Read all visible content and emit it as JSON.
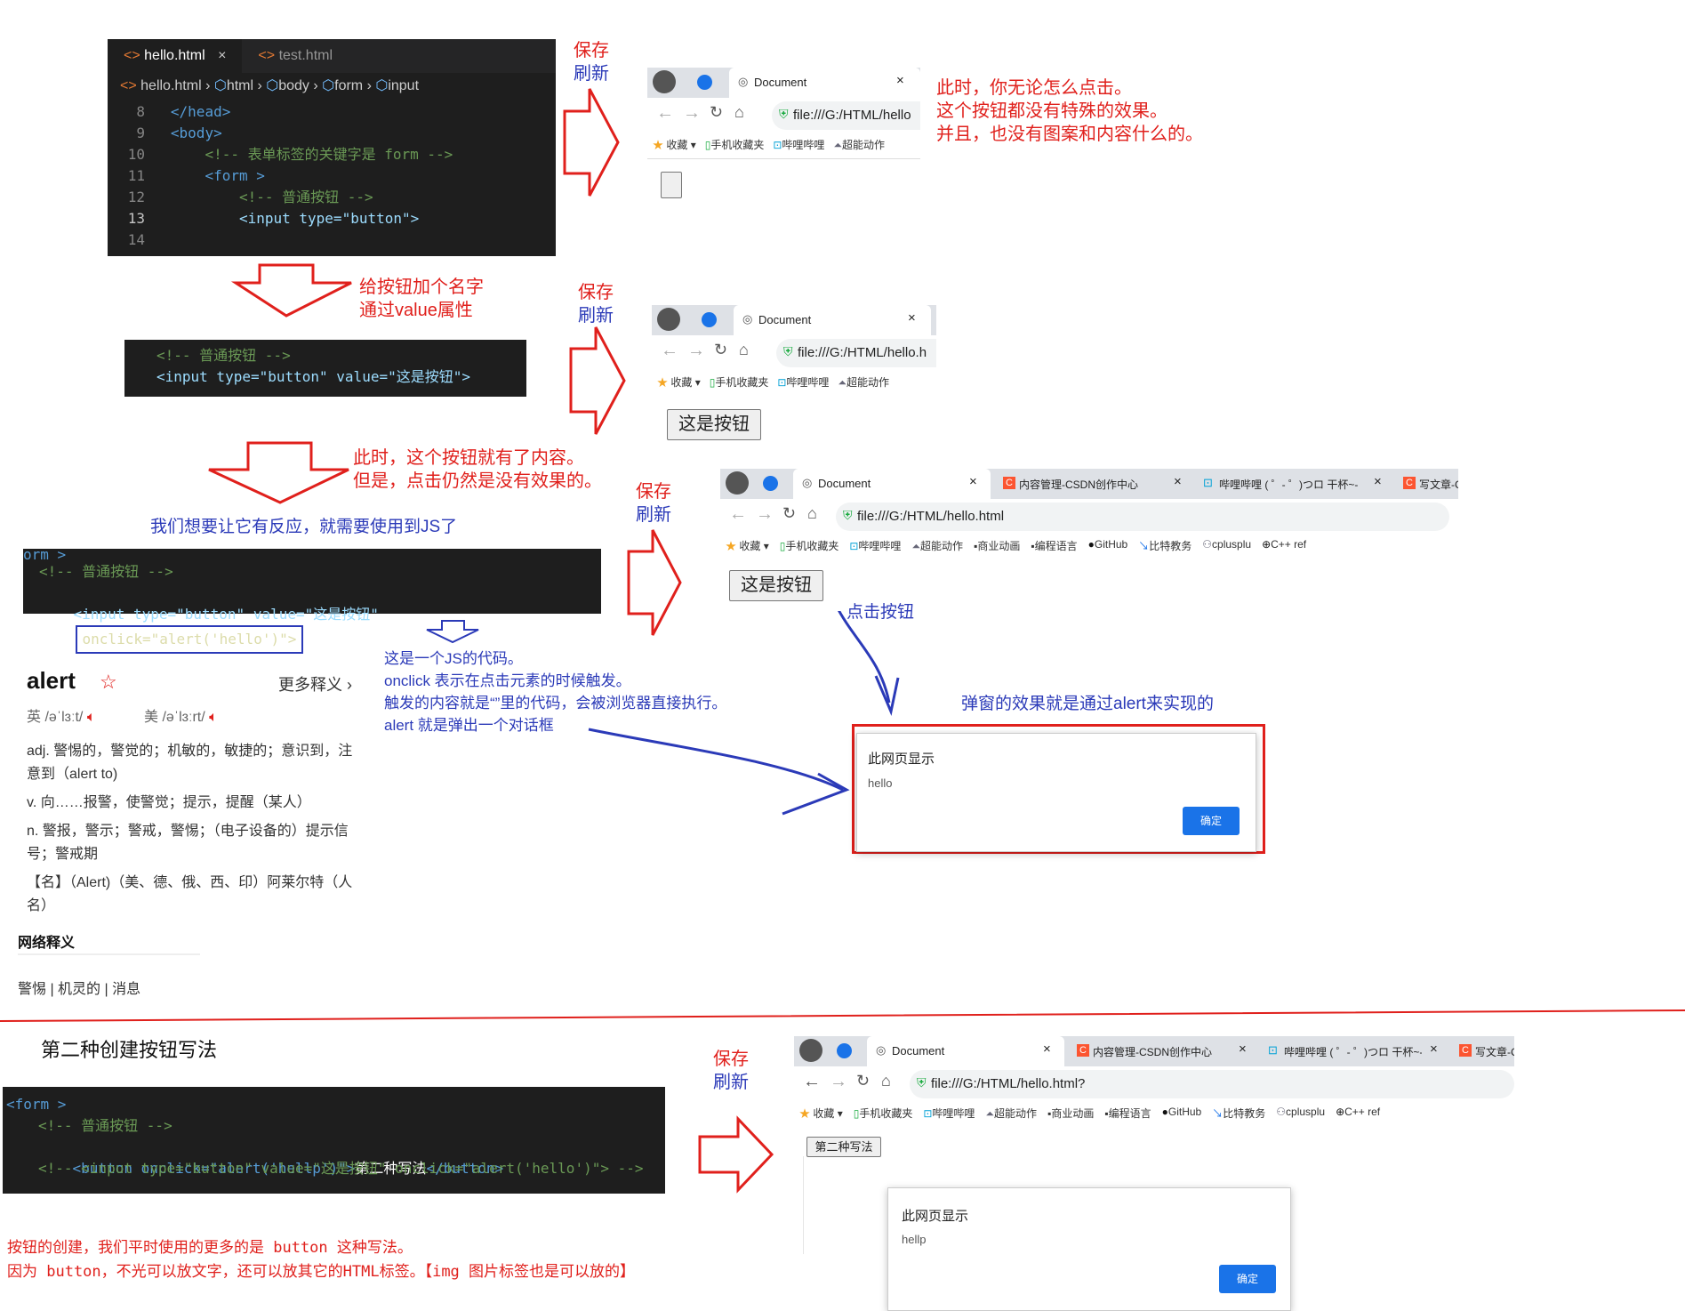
{
  "editor_main": {
    "tabs": [
      "hello.html",
      "test.html"
    ],
    "close_glyph": "×",
    "breadcrumb": [
      "hello.html",
      "html",
      "body",
      "form",
      "input"
    ],
    "lines": [
      {
        "n": "8",
        "code": "</head>"
      },
      {
        "n": "9",
        "code": "<body>"
      },
      {
        "n": "10",
        "code": "<!-- 表单标签的关键字是 form -->"
      },
      {
        "n": "11",
        "code": "<form >"
      },
      {
        "n": "12",
        "code": "<!-- 普通按钮 -->"
      },
      {
        "n": "13",
        "code": "<input type=\"button\">"
      },
      {
        "n": "14",
        "code": ""
      }
    ]
  },
  "annotations": {
    "save_refresh": [
      "保存",
      "刷新"
    ],
    "note_no_effect": [
      "此时，你无论怎么点击。",
      "这个按钮都没有特殊的效果。",
      "并且，也没有图案和内容什么的。"
    ],
    "note_value": [
      "给按钮加个名字",
      "通过value属性"
    ],
    "note_content": [
      "此时，这个按钮就有了内容。",
      "但是，点击仍然是没有效果的。"
    ],
    "note_js": "我们想要让它有反应，就需要使用到JS了",
    "note_click": "点击按钮",
    "note_popup": "弹窗的效果就是通过alert来实现的",
    "note_onclick": [
      "这是一个JS的代码。",
      "onclick 表示在点击元素的时候触发。",
      "触发的内容就是“”里的代码，会被浏览器直接执行。",
      "alert 就是弹出一个对话框"
    ],
    "second_title": "第二种创建按钮写法",
    "bottom_note": [
      "按钮的创建，我们平时使用的更多的是 button 这种写法。",
      "因为 button，不光可以放文字，还可以放其它的HTML标签。【img 图片标签也是可以放的】"
    ]
  },
  "snippet_value": {
    "comment": "<!-- 普通按钮 -->",
    "code": "<input type=\"button\" value=\"这是按钮\">"
  },
  "snippet_onclick": {
    "partial": "orm >",
    "comment": "<!-- 普通按钮 -->",
    "code_a": "<input type=\"button\" value=\"这是按钮\"",
    "code_b": "onclick=\"alert('hello')\">"
  },
  "snippet_button": {
    "l1": "<form >",
    "l2": "<!-- 普通按钮 -->",
    "l3a": "<button onclick=\"alert('hellp')\">",
    "l3b": "第二种写法",
    "l3c": "</button>",
    "l4": "<!-- <input type=\"button\" value=\"这是按钮\" onclick=\"alert('hello')\"> -->"
  },
  "browser": {
    "tab_title": "Document",
    "tab_csdn": "内容管理-CSDN创作中心",
    "tab_bili": "哔哩哔哩 ( ゜- ゜)つロ 干杯~-",
    "tab_write": "写文章-C",
    "url_1": "file:///G:/HTML/hello",
    "url_2": "file:///G:/HTML/hello.h",
    "url_3": "file:///G:/HTML/hello.html",
    "url_4": "file:///G:/HTML/hello.html?",
    "bookmarks_short": [
      "收藏",
      "手机收藏夹",
      "哔哩哔哩",
      "超能动作"
    ],
    "bookmarks_long": [
      "收藏",
      "手机收藏夹",
      "哔哩哔哩",
      "超能动作",
      "商业动画",
      "编程语言",
      "GitHub",
      "比特教务",
      "cplusplu",
      "C++ ref"
    ],
    "button_label": "这是按钮",
    "button_label_2": "第二种写法"
  },
  "dialog_1": {
    "title": "此网页显示",
    "message": "hello",
    "ok": "确定"
  },
  "dialog_2": {
    "title": "此网页显示",
    "message": "hellp",
    "ok": "确定"
  },
  "dictionary": {
    "word": "alert",
    "more": "更多释义",
    "uk": "英 /əˈlɜːt/",
    "us": "美 /əˈlɜːrt/",
    "defs": [
      "adj. 警惕的，警觉的；机敏的，敏捷的；意识到，注意到（alert to)",
      "v. 向……报警，使警觉；提示，提醒（某人）",
      "n. 警报，警示；警戒，警惕；（电子设备的）提示信号；警戒期",
      "【名】（Alert)（美、德、俄、西、印）阿莱尔特（人名）"
    ],
    "net_title": "网络释义",
    "net_defs": "警惕 | 机灵的 | 消息"
  },
  "colors": {
    "annotation_red": "#e0201c",
    "annotation_blue": "#2b3ab8",
    "editor_bg": "#1e1e1e",
    "ok_blue": "#1a73e8"
  }
}
